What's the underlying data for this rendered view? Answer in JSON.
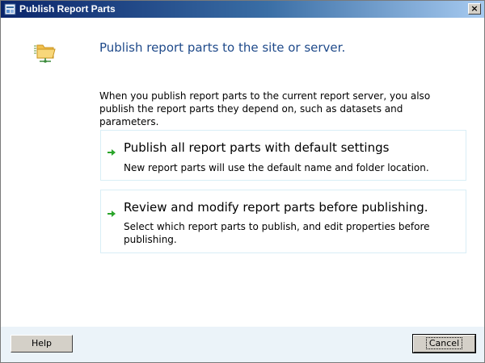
{
  "window": {
    "title": "Publish Report Parts",
    "close_glyph": "×"
  },
  "icons": {
    "app": "report-builder-icon",
    "folder": "network-folder-icon",
    "arrow": "green-arrow-icon"
  },
  "colors": {
    "heading": "#1f4a8a",
    "option_border": "#d9eef6",
    "footer_bg": "#ebf3f9",
    "arrow": "#2aa52a"
  },
  "main": {
    "heading": "Publish report parts to the site or server.",
    "intro": "When you publish report parts to the current report server, you also publish the report parts they depend on, such as datasets and parameters.",
    "options": [
      {
        "title": "Publish all report parts with default settings",
        "description": "New report parts will use the default name and folder location."
      },
      {
        "title": "Review and modify report parts before publishing.",
        "description": "Select which report parts to publish, and edit properties before publishing."
      }
    ]
  },
  "footer": {
    "help_label": "Help",
    "cancel_label": "Cancel"
  }
}
